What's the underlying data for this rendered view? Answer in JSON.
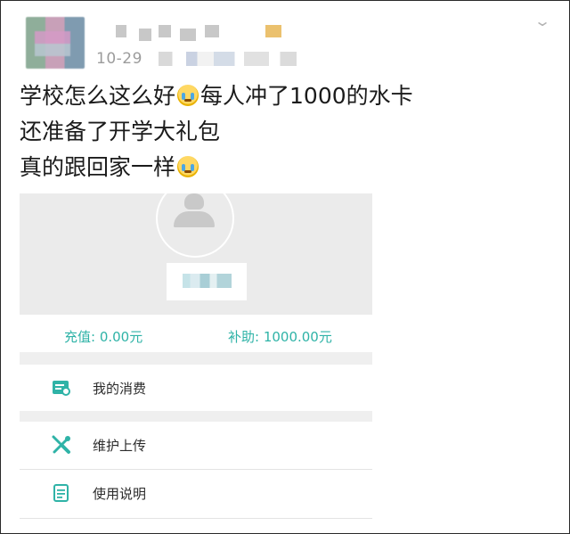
{
  "post": {
    "date": "10-29",
    "lines": [
      {
        "before": "学校怎么这么好",
        "emoji": "crying-face",
        "after": "每人冲了1000的水卡"
      },
      {
        "before": "还准备了开学大礼包",
        "emoji": "",
        "after": ""
      },
      {
        "before": "真的跟回家一样",
        "emoji": "crying-face",
        "after": ""
      }
    ]
  },
  "card": {
    "recharge": "充值: 0.00元",
    "subsidy": "补助: 1000.00元",
    "menu": [
      {
        "label": "我的消费",
        "icon": "receipt-icon"
      },
      {
        "label": "维护上传",
        "icon": "tools-icon"
      },
      {
        "label": "使用说明",
        "icon": "document-icon"
      }
    ]
  },
  "colors": {
    "accent": "#2fb3a7",
    "card_header_bg": "#ebebeb",
    "text": "#1b1b1b"
  }
}
